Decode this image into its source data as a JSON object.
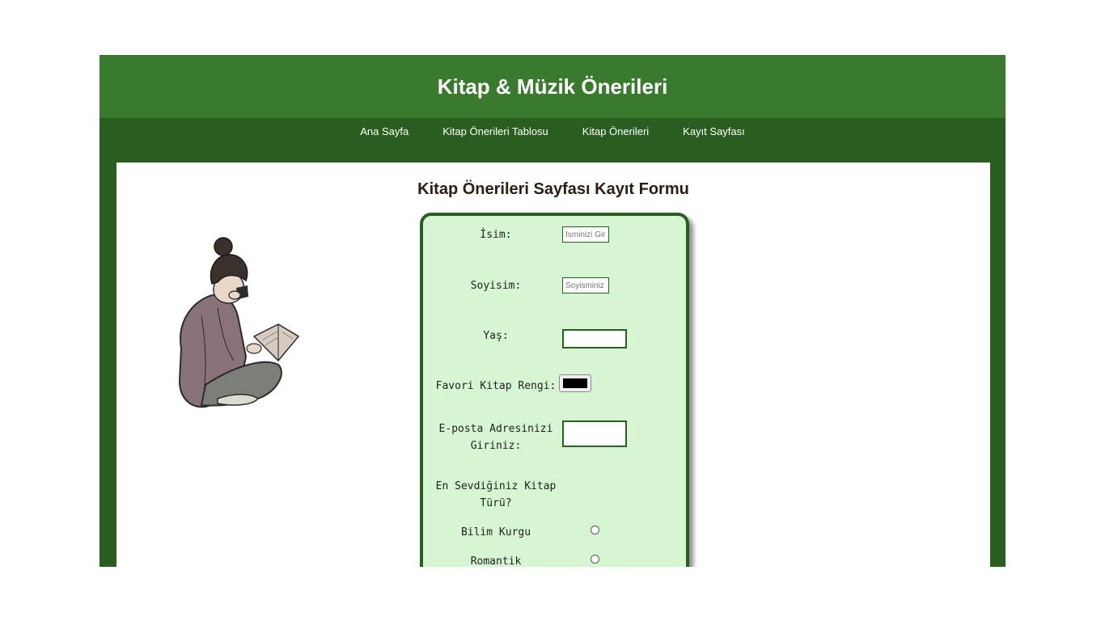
{
  "header": {
    "title": "Kitap & Müzik Önerileri"
  },
  "nav": {
    "items": [
      {
        "label": "Ana Sayfa"
      },
      {
        "label": "Kitap Önerileri Tablosu"
      },
      {
        "label": "Kitap Önerileri"
      },
      {
        "label": "Kayıt Sayfası"
      }
    ]
  },
  "form": {
    "title": "Kitap Önerileri Sayfası Kayıt Formu",
    "name_label": "İsim:",
    "name_placeholder": "İsminizi Giriniz",
    "surname_label": "Soyisim:",
    "surname_placeholder": "Soyisminiz",
    "age_label": "Yaş:",
    "color_label": "Favori Kitap Rengi:",
    "color_value": "#000000",
    "email_label": "E-posta Adresinizi Giriniz:",
    "genre_question": "En Sevdiğiniz Kitap Türü?",
    "genres": [
      {
        "label": "Bilim Kurgu"
      },
      {
        "label": "Romantik"
      }
    ]
  },
  "colors": {
    "header_bg": "#3a7a2e",
    "site_bg": "#2a5e20",
    "form_bg": "#d6f5d2"
  },
  "icons": [
    "reading-woman-illustration"
  ]
}
